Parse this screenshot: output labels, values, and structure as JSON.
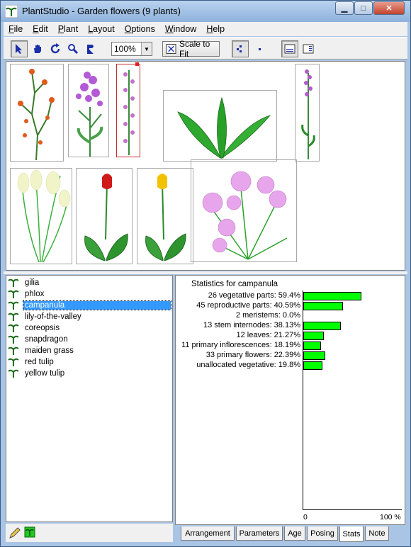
{
  "window": {
    "title": "PlantStudio - Garden flowers (9 plants)"
  },
  "menu": [
    {
      "label": "File",
      "key": "F",
      "rest": "ile"
    },
    {
      "label": "Edit",
      "key": "E",
      "rest": "dit"
    },
    {
      "label": "Plant",
      "key": "P",
      "rest": "lant"
    },
    {
      "label": "Layout",
      "key": "L",
      "rest": "ayout"
    },
    {
      "label": "Options",
      "key": "O",
      "rest": "ptions"
    },
    {
      "label": "Window",
      "key": "W",
      "rest": "indow"
    },
    {
      "label": "Help",
      "key": "H",
      "rest": "elp"
    }
  ],
  "toolbar": {
    "tools": [
      "arrow-select-icon",
      "hand-icon",
      "rotate-icon",
      "magnify-icon",
      "drag-pose-icon"
    ],
    "zoom_value": "100%",
    "scale_to_fit_label": "Scale to Fit"
  },
  "plants": [
    {
      "name": "gilia"
    },
    {
      "name": "phlox"
    },
    {
      "name": "campanula",
      "selected": true
    },
    {
      "name": "lily-of-the-valley"
    },
    {
      "name": "coreopsis"
    },
    {
      "name": "snapdragon"
    },
    {
      "name": "maiden grass"
    },
    {
      "name": "red tulip"
    },
    {
      "name": "yellow tulip"
    }
  ],
  "stats": {
    "title": "Statistics for campanula",
    "rows": [
      {
        "label": "26 vegetative parts: 59.4%",
        "percent": 59.4
      },
      {
        "label": "45 reproductive parts: 40.59%",
        "percent": 40.59
      },
      {
        "label": "2 meristems: 0.0%",
        "percent": 0.0
      },
      {
        "label": "13 stem internodes: 38.13%",
        "percent": 38.13
      },
      {
        "label": "12 leaves: 21.27%",
        "percent": 21.27
      },
      {
        "label": "11 primary inflorescences: 18.19%",
        "percent": 18.19
      },
      {
        "label": "33 primary flowers: 22.39%",
        "percent": 22.39
      },
      {
        "label": "unallocated vegetative: 19.8%",
        "percent": 19.8
      }
    ],
    "axis_min": "0",
    "axis_max": "100 %"
  },
  "tabs": [
    {
      "label": "Arrangement"
    },
    {
      "label": "Parameters"
    },
    {
      "label": "Age"
    },
    {
      "label": "Posing"
    },
    {
      "label": "Stats",
      "active": true
    },
    {
      "label": "Note"
    }
  ],
  "colors": {
    "bar": "#00ff00",
    "selection": "#3399ff",
    "accent_leaf": "#2aa02a"
  }
}
